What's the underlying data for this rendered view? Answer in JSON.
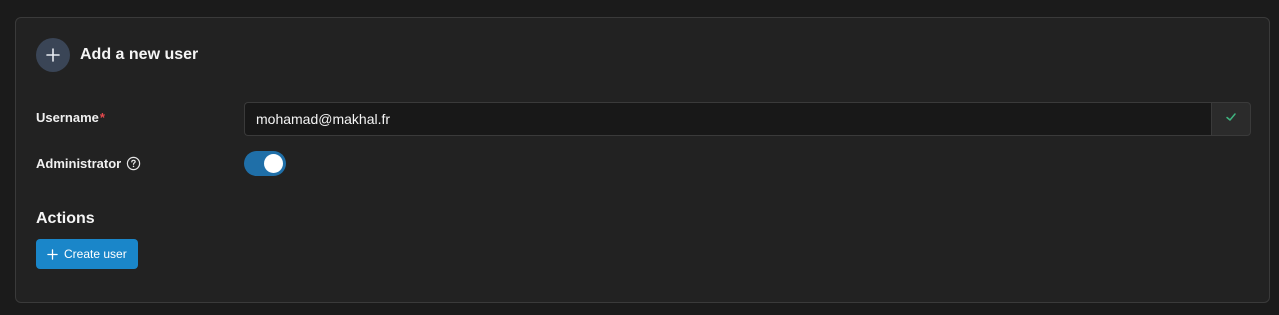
{
  "header": {
    "title": "Add a new user",
    "icon": "plus-icon"
  },
  "form": {
    "username": {
      "label": "Username",
      "required_mark": "*",
      "value": "mohamad@makhal.fr",
      "confirm_icon": "check-icon"
    },
    "administrator": {
      "label": "Administrator",
      "help_icon": "question-circle-icon",
      "enabled": true
    }
  },
  "actions": {
    "title": "Actions",
    "create_button": {
      "label": "Create user",
      "icon": "plus-icon"
    }
  },
  "colors": {
    "accent": "#1a86c9",
    "toggle_on": "#1f6fa8",
    "required": "#e5484d",
    "success": "#3fb37f"
  }
}
